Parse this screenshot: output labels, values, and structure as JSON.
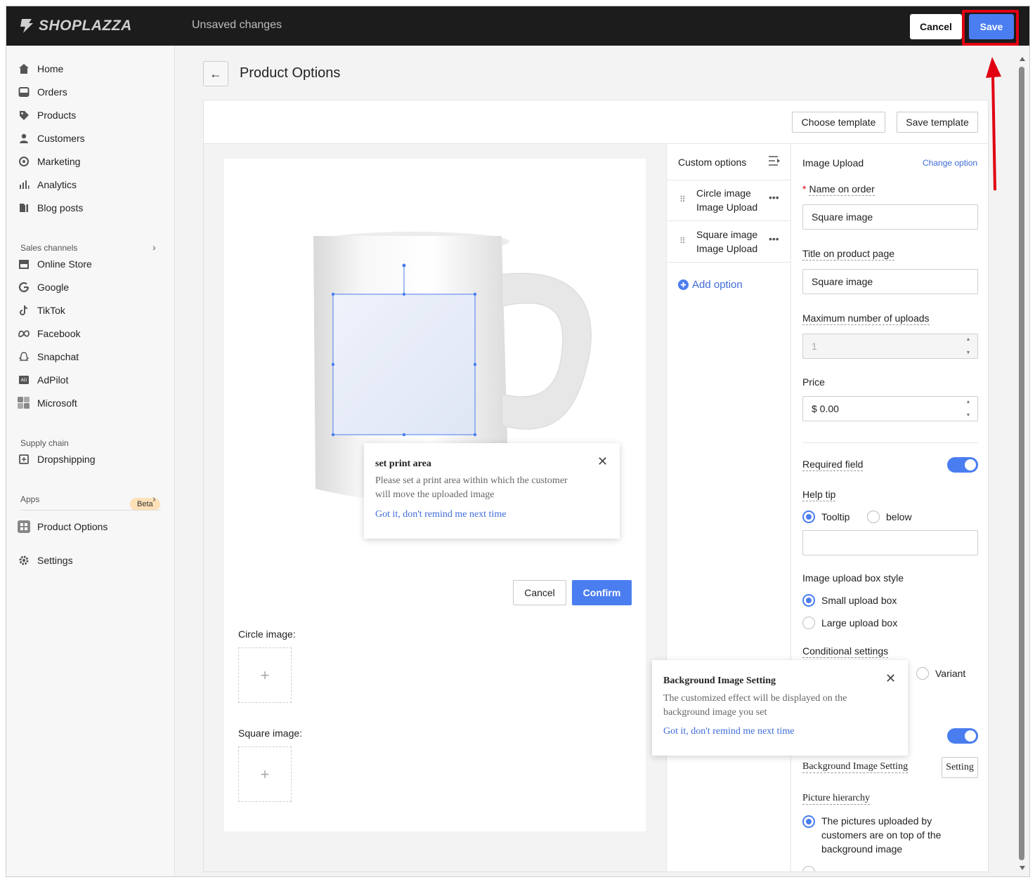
{
  "topbar": {
    "brand": "SHOPLAZZA",
    "status": "Unsaved changes",
    "cancel_label": "Cancel",
    "save_label": "Save"
  },
  "sidebar": {
    "items": [
      {
        "label": "Home",
        "icon": "home-icon"
      },
      {
        "label": "Orders",
        "icon": "orders-icon"
      },
      {
        "label": "Products",
        "icon": "tag-icon"
      },
      {
        "label": "Customers",
        "icon": "person-icon"
      },
      {
        "label": "Marketing",
        "icon": "marketing-icon"
      },
      {
        "label": "Analytics",
        "icon": "bar-chart-icon"
      },
      {
        "label": "Blog posts",
        "icon": "blog-icon"
      }
    ],
    "sales_channels_label": "Sales channels",
    "channels": [
      {
        "label": "Online Store",
        "icon": "store-icon"
      },
      {
        "label": "Google",
        "icon": "google-icon"
      },
      {
        "label": "TikTok",
        "icon": "tiktok-icon"
      },
      {
        "label": "Facebook",
        "icon": "meta-icon"
      },
      {
        "label": "Snapchat",
        "icon": "ghost-icon"
      },
      {
        "label": "AdPilot",
        "icon": "ad-icon"
      },
      {
        "label": "Microsoft",
        "icon": "microsoft-icon"
      }
    ],
    "supply_chain_label": "Supply chain",
    "dropshipping_label": "Dropshipping",
    "beta_label": "Beta",
    "apps_label": "Apps",
    "product_options_label": "Product Options",
    "settings_label": "Settings"
  },
  "page": {
    "title": "Product Options",
    "choose_template": "Choose template",
    "save_template": "Save template"
  },
  "preview": {
    "popover": {
      "title": "set print area",
      "body_line1": "Please set a print area within which the customer",
      "body_line2": "will move the uploaded image",
      "link": "Got it, don't remind me next time"
    },
    "cancel_label": "Cancel",
    "confirm_label": "Confirm",
    "circle_label": "Circle image:",
    "square_label": "Square image:"
  },
  "options": {
    "header": "Custom options",
    "items": [
      {
        "name": "Circle image",
        "type": "Image Upload"
      },
      {
        "name": "Square image",
        "type": "Image Upload"
      }
    ],
    "add_label": "Add option"
  },
  "props": {
    "title": "Image Upload",
    "change_option": "Change option",
    "required_mark": "*",
    "name_on_order_label": "Name on order",
    "name_on_order_value": "Square image",
    "title_label": "Title on product page",
    "title_value": "Square image",
    "max_uploads_label": "Maximum number of uploads",
    "max_uploads_value": "1",
    "price_label": "Price",
    "price_value": "$ 0.00",
    "required_label": "Required field",
    "required_on": true,
    "help_tip_label": "Help tip",
    "tooltip_label": "Tooltip",
    "below_label": "below",
    "style_label": "Image upload box style",
    "small_label": "Small upload box",
    "large_label": "Large upload box",
    "conditional_label": "Conditional settings",
    "variant_label": "Variant",
    "bg_setting_label": "Background Image Setting",
    "setting_button": "Setting",
    "hierarchy_label": "Picture hierarchy",
    "hierarchy_line1": "The pictures uploaded by",
    "hierarchy_line2": "customers are on top of the",
    "hierarchy_line3": "background image"
  },
  "bg_popover": {
    "title": "Background Image Setting",
    "body_line1": "The customized effect will be displayed on the",
    "body_line2": "background image you set",
    "link": "Got it, don't remind me next time"
  },
  "colors": {
    "accent": "#4a7df0",
    "highlight": "#e00012",
    "topbar": "#1c1c1c"
  }
}
